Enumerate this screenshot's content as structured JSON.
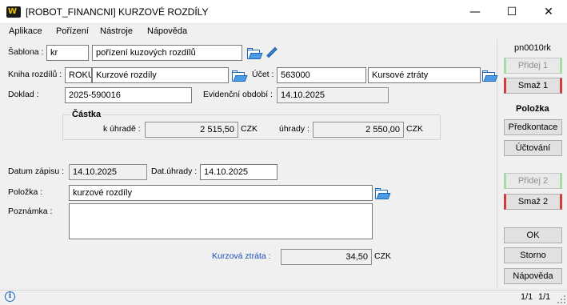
{
  "window": {
    "title": "[ROBOT_FINANCNI] KURZOVÉ ROZDÍLY",
    "app_icon_text": "W",
    "minimize_glyph": "—",
    "maximize_glyph": "☐",
    "close_glyph": "✕"
  },
  "menu": [
    "Aplikace",
    "Pořízení",
    "Nástroje",
    "Nápověda"
  ],
  "form": {
    "sablona": {
      "label": "Šablona :",
      "code": "kr",
      "name": "pořízení kuzových rozdílů"
    },
    "kniha": {
      "label": "Kniha rozdílů :",
      "code": "ROKU",
      "name": "Kurzové rozdíly"
    },
    "ucet": {
      "label": "Účet :",
      "code": "563000",
      "name": "Kursové ztráty"
    },
    "doklad": {
      "label": "Doklad :",
      "value": "2025-590016"
    },
    "evidencni": {
      "label": "Evidenční období :",
      "value": "14.10.2025"
    },
    "castka": {
      "title": "Částka",
      "k_uhrade_label": "k úhradě :",
      "k_uhrade_value": "2 515,50",
      "k_uhrade_currency": "CZK",
      "uhrady_label": "úhrady :",
      "uhrady_value": "2 550,00",
      "uhrady_currency": "CZK"
    },
    "datum_zapisu": {
      "label": "Datum zápisu :",
      "value": "14.10.2025"
    },
    "dat_uhrady": {
      "label": "Dat.úhrady :",
      "value": "14.10.2025"
    },
    "polozka": {
      "label": "Položka :",
      "value": "kurzové rozdíly"
    },
    "poznamka": {
      "label": "Poznámka :",
      "value": ""
    },
    "kurzova_ztrata": {
      "label": "Kurzová ztráta :",
      "value": "34,50",
      "currency": "CZK"
    }
  },
  "right_panel": {
    "screen_id": "pn0010rk",
    "pridej1": "Přidej 1",
    "smaz1": "Smaž 1",
    "polozka_heading": "Položka",
    "predkontace": "Předkontace",
    "uctovani": "Účtování",
    "pridej2": "Přidej 2",
    "smaz2": "Smaž 2",
    "ok": "OK",
    "storno": "Storno",
    "napoveda": "Nápověda"
  },
  "status": {
    "left": "1/1",
    "right": "1/1"
  },
  "colors": {
    "accent_label": "#1f4bb8",
    "add_green": "#4bb14b",
    "delete_red": "#d23c3c",
    "icon_blue": "#1d67b8"
  }
}
